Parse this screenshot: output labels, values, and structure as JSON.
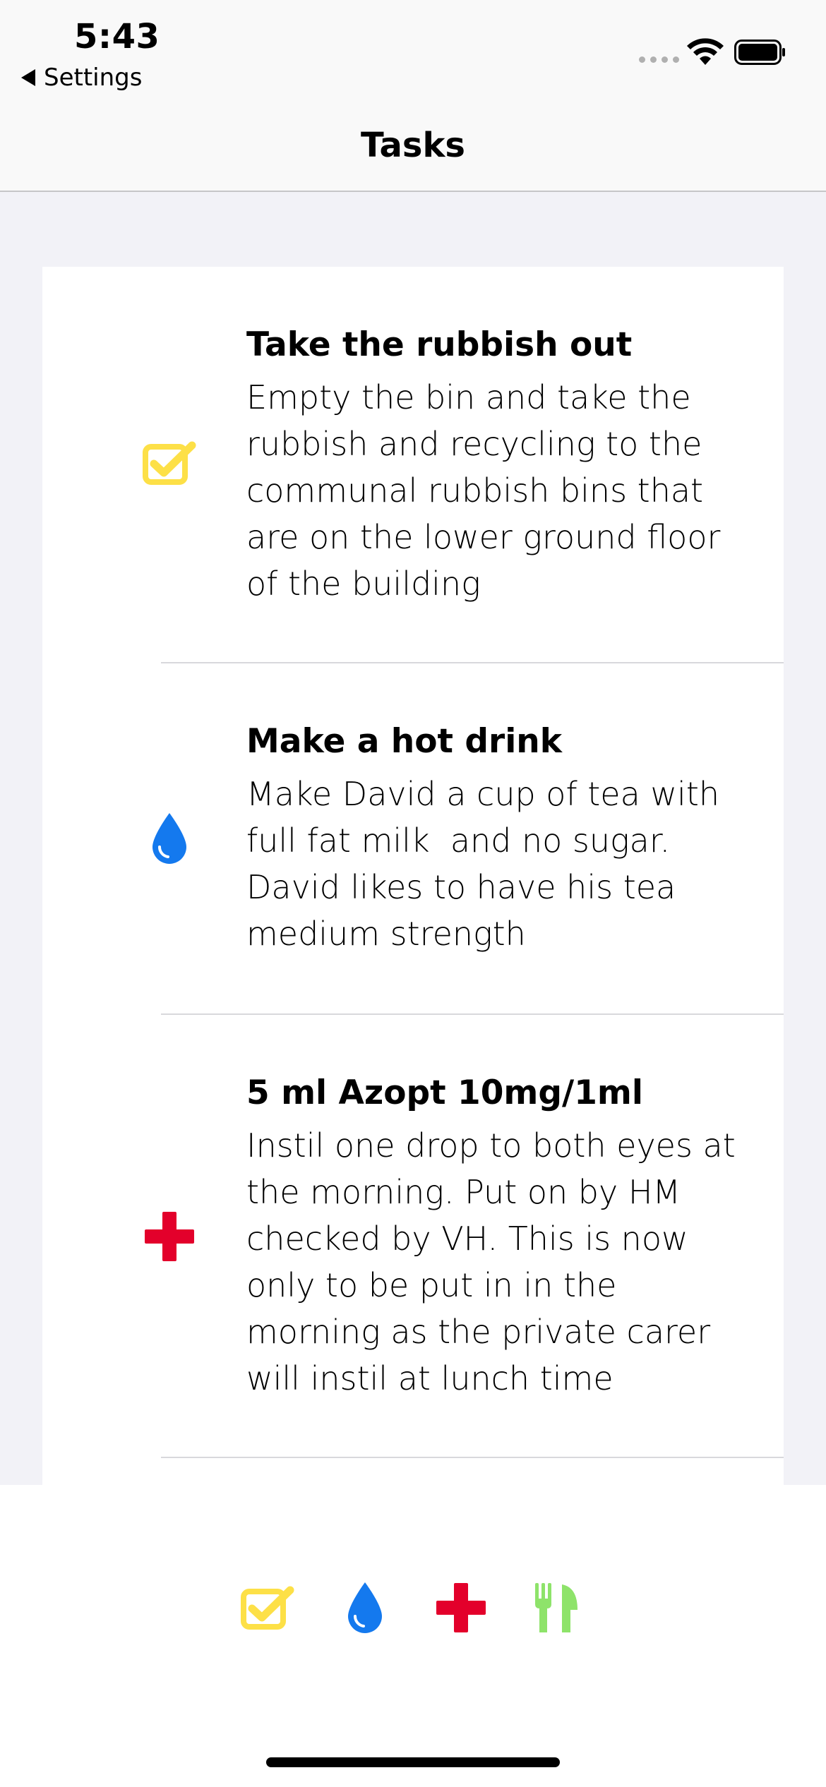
{
  "status_bar": {
    "time": "5:43",
    "back_label": "Settings"
  },
  "nav": {
    "title": "Tasks"
  },
  "colors": {
    "task_yellow": "#fde047",
    "drink_blue": "#1479ee",
    "medication_red": "#e3002b",
    "food_green": "#8ee36a"
  },
  "tasks": [
    {
      "icon": "checkbox-icon",
      "title": "Take the rubbish out",
      "description": "Empty the bin and take the\nrubbish and recycling to the\ncommunal rubbish bins that\nare on the lower ground floor\nof the building"
    },
    {
      "icon": "water-drop-icon",
      "title": "Make a hot drink",
      "description": "Make David a cup of tea with\nfull fat milk  and no sugar.\nDavid likes to have his tea\nmedium strength"
    },
    {
      "icon": "medical-cross-icon",
      "title": "5 ml Azopt 10mg/1ml",
      "description": "Instil one drop to both eyes at\nthe morning. Put on by HM\nchecked by VH. This is now\nonly to be put in in the\nmorning as the private carer\nwill instil at lunch time"
    }
  ],
  "tab_bar": {
    "icons": [
      "checkbox-icon",
      "water-drop-icon",
      "medical-cross-icon",
      "fork-knife-icon"
    ]
  }
}
